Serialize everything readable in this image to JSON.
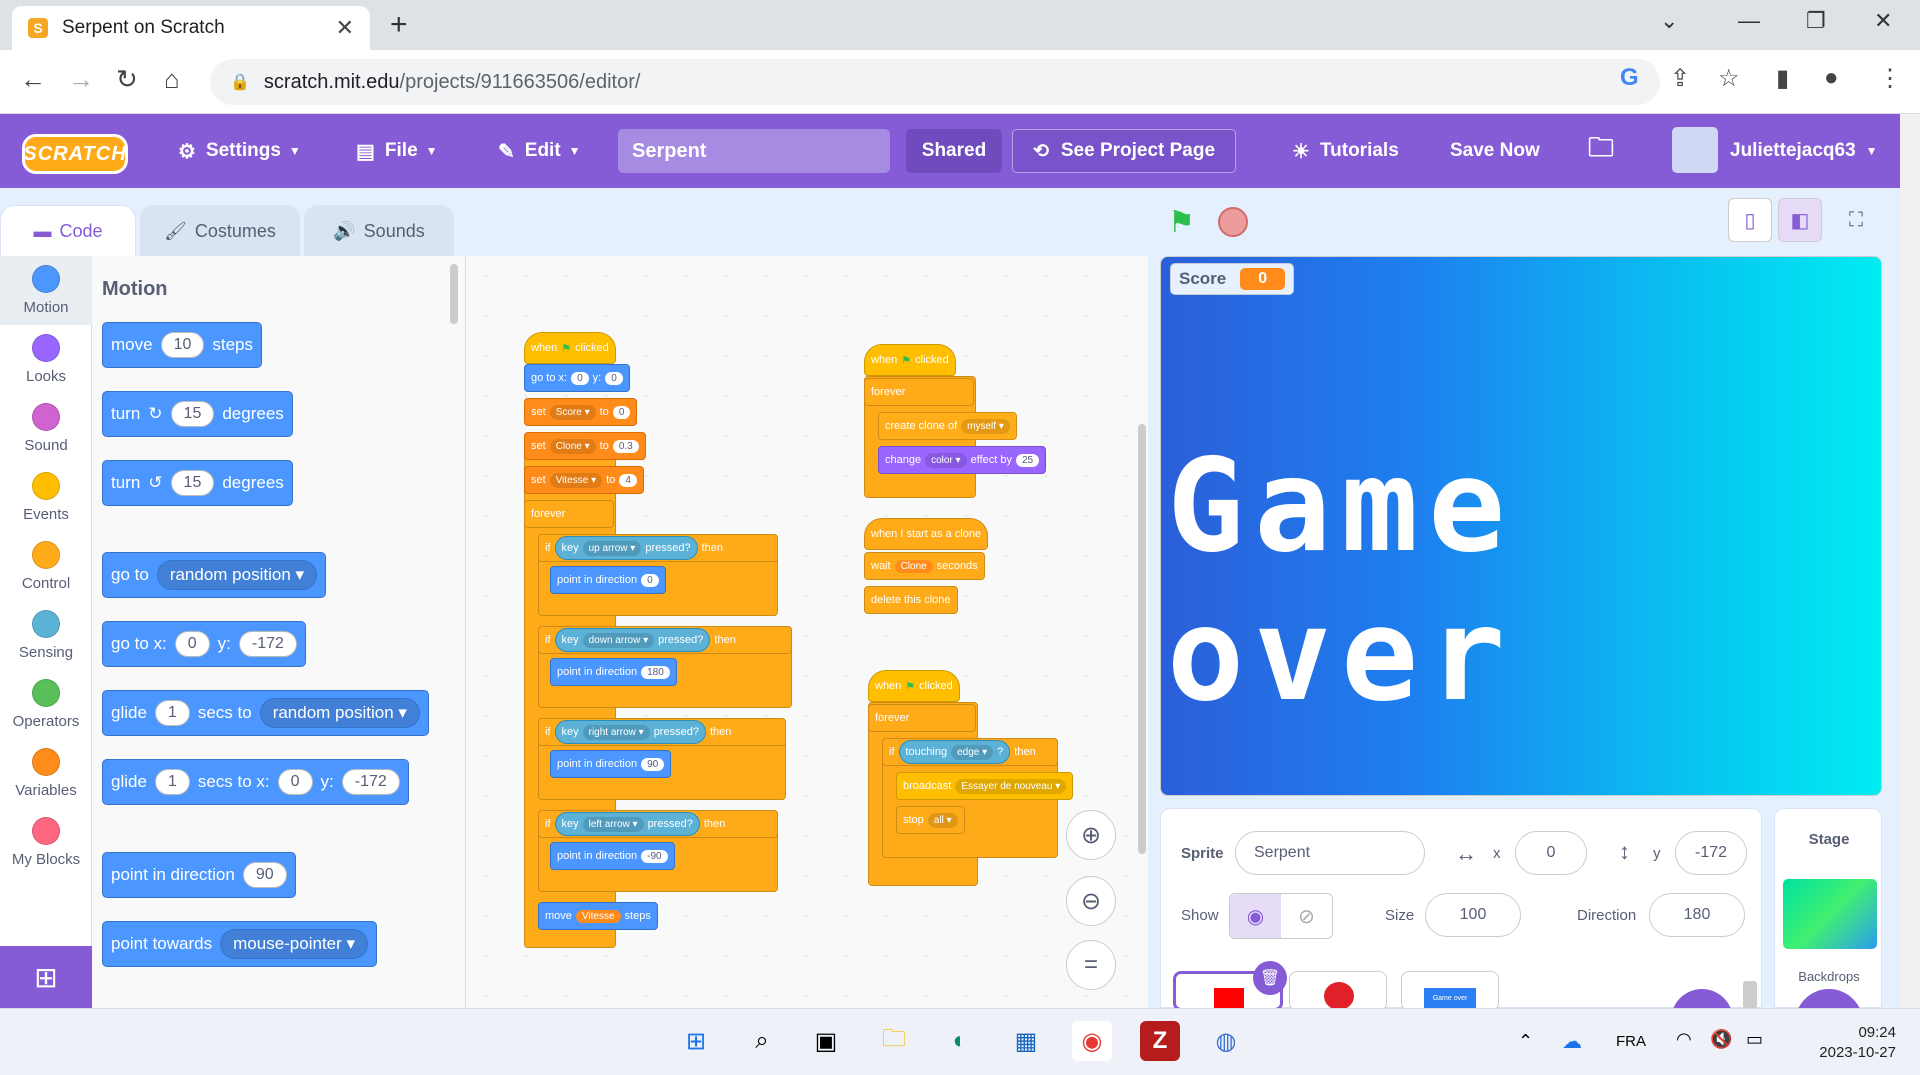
{
  "browser": {
    "tab_title": "Serpent on Scratch",
    "url_domain": "scratch.mit.edu",
    "url_path": "/projects/911663506/editor/"
  },
  "menu": {
    "logo": "SCRATCH",
    "settings": "Settings",
    "file": "File",
    "edit": "Edit",
    "project_title": "Serpent",
    "shared": "Shared",
    "see_project": "See Project Page",
    "tutorials": "Tutorials",
    "save_now": "Save Now",
    "username": "Juliettejacq63"
  },
  "tabs": {
    "code": "Code",
    "costumes": "Costumes",
    "sounds": "Sounds"
  },
  "categories": [
    {
      "label": "Motion",
      "color": "#4c97ff"
    },
    {
      "label": "Looks",
      "color": "#9966ff"
    },
    {
      "label": "Sound",
      "color": "#cf63cf"
    },
    {
      "label": "Events",
      "color": "#ffbf00"
    },
    {
      "label": "Control",
      "color": "#ffab19"
    },
    {
      "label": "Sensing",
      "color": "#5cb1d6"
    },
    {
      "label": "Operators",
      "color": "#59c059"
    },
    {
      "label": "Variables",
      "color": "#ff8c1a"
    },
    {
      "label": "My Blocks",
      "color": "#ff6680"
    }
  ],
  "palette": {
    "heading": "Motion",
    "move": {
      "a": "move",
      "v": "10",
      "b": "steps"
    },
    "turn_cw": {
      "a": "turn",
      "v": "15",
      "b": "degrees"
    },
    "turn_ccw": {
      "a": "turn",
      "v": "15",
      "b": "degrees"
    },
    "goto": {
      "a": "go to",
      "d": "random position"
    },
    "gotoxy": {
      "a": "go to x:",
      "x": "0",
      "b": "y:",
      "y": "-172"
    },
    "glide1": {
      "a": "glide",
      "v": "1",
      "b": "secs to",
      "d": "random position"
    },
    "glide2": {
      "a": "glide",
      "v": "1",
      "b": "secs to x:",
      "x": "0",
      "c": "y:",
      "y": "-172"
    },
    "pointdir": {
      "a": "point in direction",
      "v": "90"
    },
    "pointtow": {
      "a": "point towards",
      "d": "mouse-pointer"
    }
  },
  "scripts": {
    "s1": {
      "when": "when",
      "clicked": "clicked",
      "goto": "go to x:",
      "x": "0",
      "y_label": "y:",
      "y": "0",
      "set": "set",
      "to": "to",
      "var1": "Score",
      "val1": "0",
      "var2": "Clone",
      "val2": "0.3",
      "var3": "Vitesse",
      "val3": "4",
      "forever": "forever",
      "if": "if",
      "key": "key",
      "pressed": "pressed?",
      "then": "then",
      "k1": "up arrow",
      "k2": "down arrow",
      "k3": "right arrow",
      "k4": "left arrow",
      "point": "point in direction",
      "d1": "0",
      "d2": "180",
      "d3": "90",
      "d4": "-90",
      "move": "move",
      "steps": "steps",
      "mv": "Vitesse"
    },
    "s2": {
      "when": "when",
      "clicked": "clicked",
      "forever": "forever",
      "create": "create clone of",
      "myself": "myself",
      "change": "change",
      "effect": "color",
      "by": "effect by",
      "amount": "25"
    },
    "s3": {
      "hat": "when I start as a clone",
      "wait": "wait",
      "wv": "Clone",
      "seconds": "seconds",
      "delete": "delete this clone"
    },
    "s4": {
      "when": "when",
      "clicked": "clicked",
      "forever": "forever",
      "if": "if",
      "touching": "touching",
      "edge": "edge",
      "q": "?",
      "then": "then",
      "broadcast": "broadcast",
      "msg": "Essayer de nouveau",
      "stop": "stop",
      "all": "all"
    }
  },
  "stage": {
    "score_label": "Score",
    "score_value": "0",
    "gameover": "Game over"
  },
  "sprite": {
    "sprite_label": "Sprite",
    "name": "Serpent",
    "x_label": "x",
    "x": "0",
    "y_label": "y",
    "y": "-172",
    "show_label": "Show",
    "size_label": "Size",
    "size": "100",
    "direction_label": "Direction",
    "direction": "180",
    "thumb3_text": "Game over"
  },
  "stage_pane": {
    "title": "Stage",
    "backdrops": "Backdrops"
  },
  "taskbar": {
    "lang": "FRA",
    "time": "09:24",
    "date": "2023-10-27"
  }
}
